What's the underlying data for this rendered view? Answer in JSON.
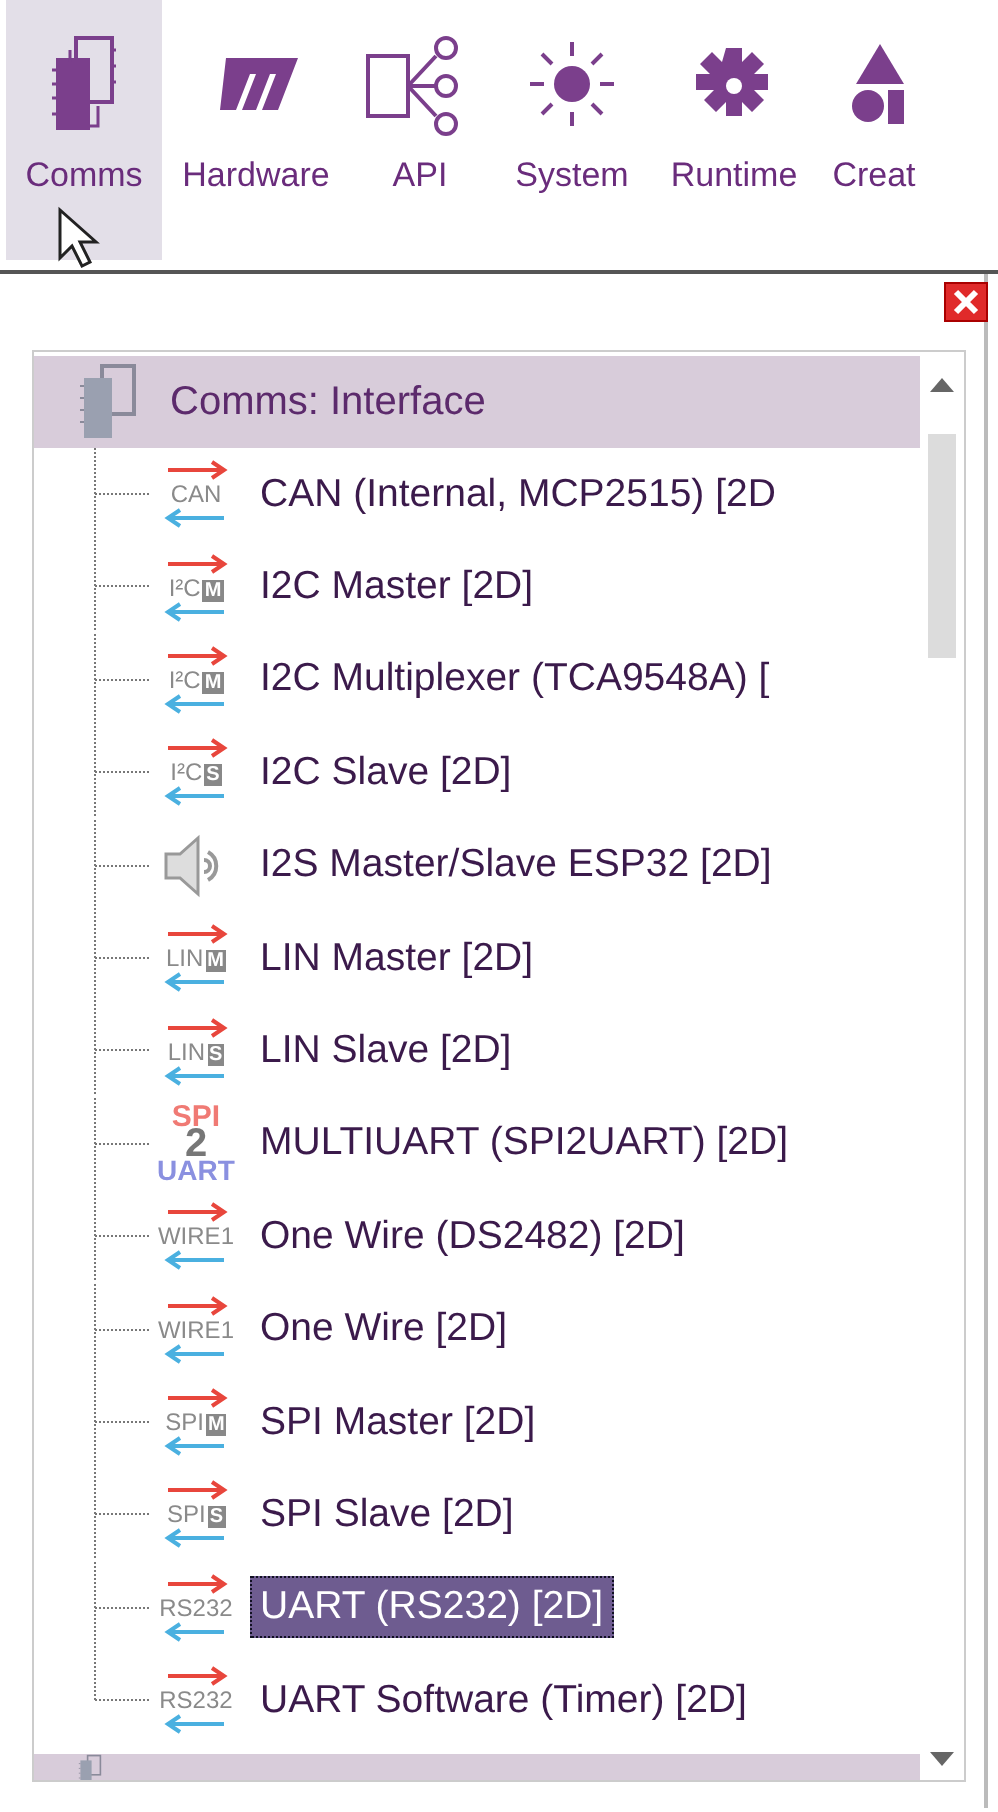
{
  "toolbar": {
    "items": [
      {
        "label": "Comms",
        "selected": true
      },
      {
        "label": "Hardware",
        "selected": false
      },
      {
        "label": "API",
        "selected": false
      },
      {
        "label": "System",
        "selected": false
      },
      {
        "label": "Runtime",
        "selected": false
      },
      {
        "label": "Creat",
        "selected": false
      }
    ]
  },
  "panel": {
    "groups": [
      {
        "kind": "group",
        "title": "Comms: Interface",
        "items": [
          {
            "label": "CAN (Internal, MCP2515) [2D",
            "selected": false,
            "icon": {
              "kind": "arrows",
              "text": "CAN"
            }
          },
          {
            "label": "I2C Master [2D]",
            "selected": false,
            "icon": {
              "kind": "arrows",
              "text": "I²C",
              "badge": "M"
            }
          },
          {
            "label": "I2C Multiplexer (TCA9548A) [",
            "selected": false,
            "icon": {
              "kind": "arrows",
              "text": "I²C",
              "badge": "M"
            }
          },
          {
            "label": "I2C Slave [2D]",
            "selected": false,
            "icon": {
              "kind": "arrows",
              "text": "I²C",
              "badge": "S"
            }
          },
          {
            "label": "I2S Master/Slave ESP32 [2D]",
            "selected": false,
            "icon": {
              "kind": "speaker"
            }
          },
          {
            "label": "LIN Master [2D]",
            "selected": false,
            "icon": {
              "kind": "arrows",
              "text": "LIN",
              "badge": "M"
            }
          },
          {
            "label": "LIN Slave [2D]",
            "selected": false,
            "icon": {
              "kind": "arrows",
              "text": "LIN",
              "badge": "S"
            }
          },
          {
            "label": "MULTIUART (SPI2UART) [2D]",
            "selected": false,
            "icon": {
              "kind": "stack",
              "top": "SPI",
              "middle": "2",
              "bottom": "UART"
            }
          },
          {
            "label": "One Wire (DS2482) [2D]",
            "selected": false,
            "icon": {
              "kind": "arrows",
              "text": "WIRE1"
            }
          },
          {
            "label": "One Wire [2D]",
            "selected": false,
            "icon": {
              "kind": "arrows",
              "text": "WIRE1"
            }
          },
          {
            "label": "SPI Master [2D]",
            "selected": false,
            "icon": {
              "kind": "arrows",
              "text": "SPI",
              "badge": "M"
            }
          },
          {
            "label": "SPI Slave [2D]",
            "selected": false,
            "icon": {
              "kind": "arrows",
              "text": "SPI",
              "badge": "S"
            }
          },
          {
            "label": "UART (RS232) [2D]",
            "selected": true,
            "icon": {
              "kind": "arrows",
              "text": "RS232"
            }
          },
          {
            "label": "UART Software (Timer) [2D]",
            "selected": false,
            "icon": {
              "kind": "arrows",
              "text": "RS232"
            }
          }
        ]
      },
      {
        "kind": "group"
      }
    ]
  }
}
